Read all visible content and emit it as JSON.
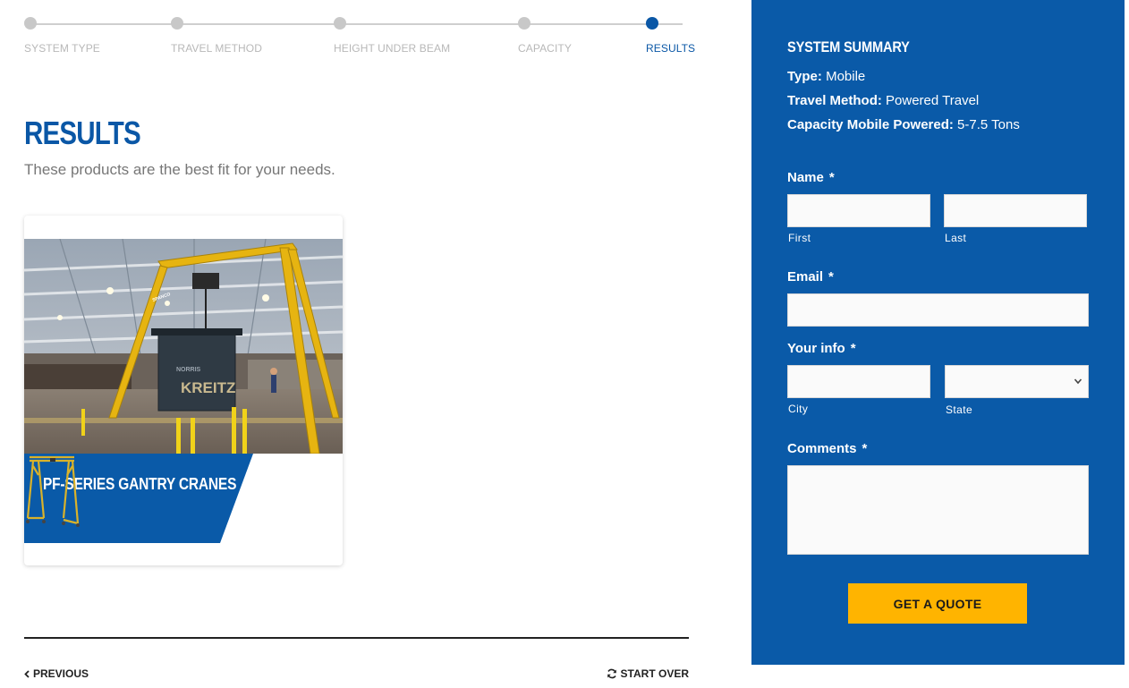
{
  "steps": [
    {
      "label": "SYSTEM TYPE"
    },
    {
      "label": "TRAVEL METHOD"
    },
    {
      "label": "HEIGHT UNDER BEAM"
    },
    {
      "label": "CAPACITY"
    },
    {
      "label": "RESULTS"
    }
  ],
  "results": {
    "title": "RESULTS",
    "subtitle": "These products are the best fit for your needs."
  },
  "product": {
    "title": "PF-SERIES GANTRY CRANES",
    "photo_sign_top": "NORRIS",
    "photo_sign_main": "KREITZ",
    "photo_beam_label": "SPANCO"
  },
  "nav": {
    "previous": "PREVIOUS",
    "start_over": "START OVER"
  },
  "summary": {
    "title": "SYSTEM SUMMARY",
    "type_label": "Type:",
    "type_value": "Mobile",
    "travel_label": "Travel Method:",
    "travel_value": "Powered Travel",
    "capacity_label": "Capacity Mobile Powered:",
    "capacity_value": "5-7.5 Tons"
  },
  "form": {
    "name_label": "Name",
    "email_label": "Email",
    "info_label": "Your info",
    "comments_label": "Comments",
    "required_mark": "*",
    "first_sub": "First",
    "last_sub": "Last",
    "city_sub": "City",
    "state_sub": "State",
    "first_value": "",
    "last_value": "",
    "email_value": "",
    "city_value": "",
    "state_value": "",
    "comments_value": "",
    "submit_label": "GET A QUOTE"
  },
  "colors": {
    "brand_blue": "#0a5aa8",
    "accent_yellow": "#ffb400",
    "inactive_step": "#c8c8c8"
  }
}
